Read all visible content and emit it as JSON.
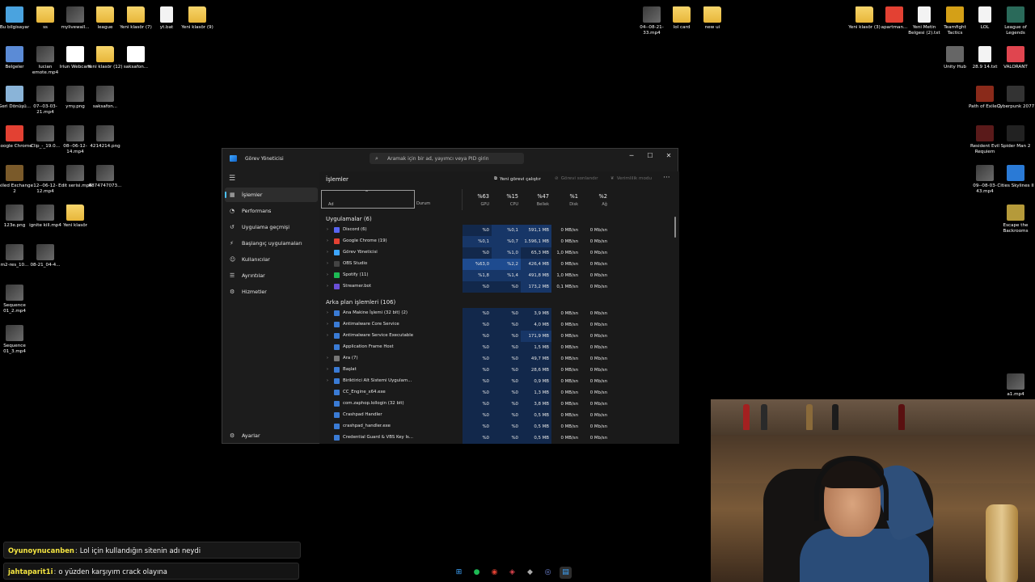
{
  "desktop_icons": [
    {
      "label": "Bu bilgisayar",
      "kind": "app",
      "color": "#4aa3df"
    },
    {
      "label": "ss",
      "kind": "folder"
    },
    {
      "label": "mylivewall...",
      "kind": "thumb"
    },
    {
      "label": "league",
      "kind": "folder"
    },
    {
      "label": "Yeni klasör (7)",
      "kind": "folder"
    },
    {
      "label": "yt.bat",
      "kind": "doc"
    },
    {
      "label": "Yeni klasör (9)",
      "kind": "folder"
    },
    {
      "label": "Belgeler",
      "kind": "app",
      "color": "#5b8bd6"
    },
    {
      "label": "lucian emote.mp4",
      "kind": "thumb"
    },
    {
      "label": "Iriun Webcam",
      "kind": "app",
      "color": "#ffffff"
    },
    {
      "label": "Yeni klasör (12)",
      "kind": "folder"
    },
    {
      "label": "saksafon...",
      "kind": "app",
      "color": "#ffffff"
    },
    {
      "label": "Geri Dönüşü...",
      "kind": "app",
      "color": "#8ab4d8"
    },
    {
      "label": "07--03-03-21.mp4",
      "kind": "thumb"
    },
    {
      "label": "ymy.png",
      "kind": "thumb"
    },
    {
      "label": "saksafon...",
      "kind": "thumb"
    },
    {
      "label": "Google Chrome",
      "kind": "app",
      "color": "#e34133"
    },
    {
      "label": "Clip_-_19.0...",
      "kind": "thumb"
    },
    {
      "label": "08--06-12-14.mp4",
      "kind": "thumb"
    },
    {
      "label": "4214214.png",
      "kind": "thumb"
    },
    {
      "label": "Exiled Exchange 2",
      "kind": "app",
      "color": "#7a5a2a"
    },
    {
      "label": "12--06-12-12.mp4",
      "kind": "thumb"
    },
    {
      "label": "Edit serisi.mp4",
      "kind": "thumb"
    },
    {
      "label": "687474707​3...",
      "kind": "thumb"
    },
    {
      "label": "123e.png",
      "kind": "thumb"
    },
    {
      "label": "ignite kill.mp4",
      "kind": "thumb"
    },
    {
      "label": "Yeni klasör",
      "kind": "folder"
    },
    {
      "label": "m2-res_10...",
      "kind": "thumb"
    },
    {
      "label": "08-21_04-4...",
      "kind": "thumb"
    },
    {
      "label": "Sequence 01_2.mp4",
      "kind": "thumb"
    },
    {
      "label": "Sequence 01_3.mp4",
      "kind": "thumb"
    },
    {
      "label": "04--08-21-33.mp4",
      "kind": "thumb"
    },
    {
      "label": "lol card",
      "kind": "folder"
    },
    {
      "label": "new ui",
      "kind": "folder"
    },
    {
      "label": "Yeni klasör (3)",
      "kind": "folder"
    },
    {
      "label": "apartman...",
      "kind": "app",
      "color": "#e34133"
    },
    {
      "label": "Yeni Metin Belgesi (2).txt",
      "kind": "doc"
    },
    {
      "label": "Teamfight Tactics",
      "kind": "app",
      "color": "#d4a017"
    },
    {
      "label": "LOL",
      "kind": "doc"
    },
    {
      "label": "League of Legends",
      "kind": "app",
      "color": "#2a6a5a"
    },
    {
      "label": "Unity Hub",
      "kind": "app",
      "color": "#666666"
    },
    {
      "label": "28.9 14.txt",
      "kind": "doc"
    },
    {
      "label": "VALORANT",
      "kind": "app",
      "color": "#e0454f"
    },
    {
      "label": "Path of Exile 2",
      "kind": "app",
      "color": "#8a2a1a"
    },
    {
      "label": "Cyberpunk 2077",
      "kind": "app",
      "color": "#333333"
    },
    {
      "label": "Resident Evil Requiem",
      "kind": "app",
      "color": "#5a1a1a"
    },
    {
      "label": "Spider Man 2",
      "kind": "app",
      "color": "#222222"
    },
    {
      "label": "09--08-03-43.mp4",
      "kind": "thumb"
    },
    {
      "label": "Cities Skylines II",
      "kind": "app",
      "color": "#2a7ad6"
    },
    {
      "label": "Escape the Backrooms",
      "kind": "app",
      "color": "#b59a3a"
    },
    {
      "label": "a1.mp4",
      "kind": "thumb"
    }
  ],
  "task_manager": {
    "title": "Görev Yöneticisi",
    "search_placeholder": "Aramak için bir ad, yayımcı veya PID girin",
    "nav": [
      {
        "label": "İşlemler",
        "icon": "grid-icon"
      },
      {
        "label": "Performans",
        "icon": "performance-icon"
      },
      {
        "label": "Uygulama geçmişi",
        "icon": "history-icon"
      },
      {
        "label": "Başlangıç uygulamaları",
        "icon": "startup-icon"
      },
      {
        "label": "Kullanıcılar",
        "icon": "users-icon"
      },
      {
        "label": "Ayrıntılar",
        "icon": "list-icon"
      },
      {
        "label": "Hizmetler",
        "icon": "services-icon"
      }
    ],
    "settings_label": "Ayarlar",
    "page_title": "İşlemler",
    "commands": {
      "run_new_task": "Yeni görevi çalıştır",
      "end_task": "Görevi sonlandır",
      "efficiency_mode": "Verimlilik modu"
    },
    "columns": {
      "name": "Ad",
      "status": "Durum",
      "gpu": {
        "pct": "%63",
        "label": "GPU"
      },
      "cpu": {
        "pct": "%15",
        "label": "CPU"
      },
      "memory": {
        "pct": "%47",
        "label": "Bellek"
      },
      "disk": {
        "pct": "%1",
        "label": "Disk"
      },
      "network": {
        "pct": "%2",
        "label": "Ağ"
      }
    },
    "apps_group": "Uygulamalar (6)",
    "apps": [
      {
        "name": "Discord (6)",
        "gpu": "%0",
        "cpu": "%0,1",
        "mem": "591,1 MB",
        "disk": "0 MB/sn",
        "net": "0 Mb/sn",
        "color": "#5865f2",
        "expand": true
      },
      {
        "name": "Google Chrome (19)",
        "gpu": "%0,1",
        "cpu": "%0,7",
        "mem": "1.596,1 MB",
        "disk": "0 MB/sn",
        "net": "0 Mb/sn",
        "color": "#e34133",
        "expand": true
      },
      {
        "name": "Görev Yöneticisi",
        "gpu": "%0",
        "cpu": "%1,0",
        "mem": "65,3 MB",
        "disk": "1,0 MB/sn",
        "net": "0 Mb/sn",
        "color": "#3ea6ff",
        "expand": true
      },
      {
        "name": "OBS Studio",
        "gpu": "%63,0",
        "cpu": "%2,2",
        "mem": "426,4 MB",
        "disk": "0 MB/sn",
        "net": "0 Mb/sn",
        "color": "#444444",
        "expand": true
      },
      {
        "name": "Spotify (11)",
        "gpu": "%1,8",
        "cpu": "%1,4",
        "mem": "491,8 MB",
        "disk": "1,0 MB/sn",
        "net": "0 Mb/sn",
        "color": "#1db954",
        "expand": true
      },
      {
        "name": "Streamer.bot",
        "gpu": "%0",
        "cpu": "%0",
        "mem": "173,2 MB",
        "disk": "0,1 MB/sn",
        "net": "0 Mb/sn",
        "color": "#6a4fd6",
        "expand": true
      }
    ],
    "bg_group": "Arka plan işlemleri (106)",
    "background": [
      {
        "name": "Ana Makine İşlemi (32 bit) (2)",
        "gpu": "%0",
        "cpu": "%0",
        "mem": "3,9 MB",
        "disk": "0 MB/sn",
        "net": "0 Mb/sn",
        "color": "#3a7bd5",
        "expand": true
      },
      {
        "name": "Antimalware Core Service",
        "gpu": "%0",
        "cpu": "%0",
        "mem": "4,0 MB",
        "disk": "0 MB/sn",
        "net": "0 Mb/sn",
        "color": "#3a7bd5",
        "expand": true
      },
      {
        "name": "Antimalware Service Executable",
        "gpu": "%0",
        "cpu": "%0",
        "mem": "171,9 MB",
        "disk": "0 MB/sn",
        "net": "0 Mb/sn",
        "color": "#3a7bd5",
        "expand": true
      },
      {
        "name": "Application Frame Host",
        "gpu": "%0",
        "cpu": "%0",
        "mem": "1,5 MB",
        "disk": "0 MB/sn",
        "net": "0 Mb/sn",
        "color": "#3a7bd5",
        "expand": false
      },
      {
        "name": "Ara (7)",
        "gpu": "%0",
        "cpu": "%0",
        "mem": "49,7 MB",
        "disk": "0 MB/sn",
        "net": "0 Mb/sn",
        "color": "#777777",
        "expand": true
      },
      {
        "name": "Başlat",
        "gpu": "%0",
        "cpu": "%0",
        "mem": "28,6 MB",
        "disk": "0 MB/sn",
        "net": "0 Mb/sn",
        "color": "#3a7bd5",
        "expand": true
      },
      {
        "name": "Biriktirici Alt Sistemi Uygulam...",
        "gpu": "%0",
        "cpu": "%0",
        "mem": "0,9 MB",
        "disk": "0 MB/sn",
        "net": "0 Mb/sn",
        "color": "#3a7bd5",
        "expand": true
      },
      {
        "name": "CC_Engine_x64.exe",
        "gpu": "%0",
        "cpu": "%0",
        "mem": "1,3 MB",
        "disk": "0 MB/sn",
        "net": "0 Mb/sn",
        "color": "#3a7bd5",
        "expand": false
      },
      {
        "name": "com.zaphop.lollogin (32 bit)",
        "gpu": "%0",
        "cpu": "%0",
        "mem": "3,8 MB",
        "disk": "0 MB/sn",
        "net": "0 Mb/sn",
        "color": "#3a7bd5",
        "expand": false
      },
      {
        "name": "Crashpad Handler",
        "gpu": "%0",
        "cpu": "%0",
        "mem": "0,5 MB",
        "disk": "0 MB/sn",
        "net": "0 Mb/sn",
        "color": "#3a7bd5",
        "expand": false
      },
      {
        "name": "crashpad_handler.exe",
        "gpu": "%0",
        "cpu": "%0",
        "mem": "0,5 MB",
        "disk": "0 MB/sn",
        "net": "0 Mb/sn",
        "color": "#3a7bd5",
        "expand": false
      },
      {
        "name": "Credential Guard & VBS Key Is...",
        "gpu": "%0",
        "cpu": "%0",
        "mem": "0,5 MB",
        "disk": "0 MB/sn",
        "net": "0 Mb/sn",
        "color": "#3a7bd5",
        "expand": false
      }
    ]
  },
  "chat": [
    {
      "user": "Oyunoynucanben",
      "message": "Lol için kullandığın sitenin adı neydi"
    },
    {
      "user": "jahtaparit1i",
      "message": "o yüzden karşıyım crack olayına"
    }
  ],
  "taskbar": [
    "windows-start-icon",
    "spotify-icon",
    "chrome-icon",
    "valorant-icon",
    "unity-icon",
    "discord-icon",
    "task-manager-icon"
  ]
}
